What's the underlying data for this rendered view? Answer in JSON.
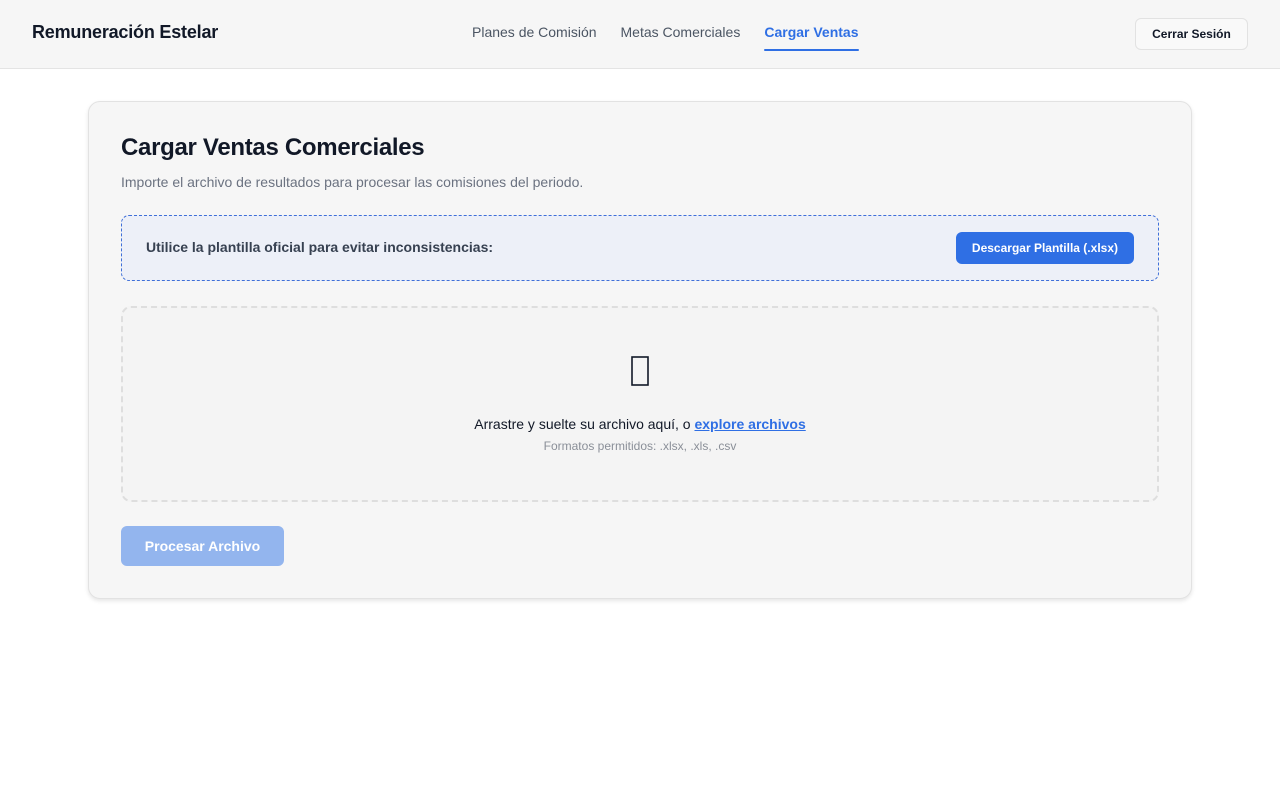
{
  "app": {
    "brand": "Remuneración Estelar"
  },
  "nav": {
    "items": [
      {
        "label": "Planes de Comisión",
        "active": false
      },
      {
        "label": "Metas Comerciales",
        "active": false
      },
      {
        "label": "Cargar Ventas",
        "active": true
      }
    ],
    "logout_label": "Cerrar Sesión"
  },
  "card": {
    "title": "Cargar Ventas Comerciales",
    "subtitle": "Importe el archivo de resultados para procesar las comisiones del periodo.",
    "template": {
      "text": "Utilice la plantilla oficial para evitar inconsistencias:",
      "button_label": "Descargar Plantilla (.xlsx)"
    },
    "dropzone": {
      "icon": "file-upload-icon",
      "prompt": "Arrastre y suelte su archivo aquí, o",
      "browse_label": "explore archivos",
      "formats": "Formatos permitidos: .xlsx, .xls, .csv"
    },
    "process_label": "Procesar Archivo",
    "process_enabled": false
  },
  "colors": {
    "accent": "#2f6fe4",
    "accent_disabled": "#93b5ee",
    "template_bg": "#edf0f8",
    "template_border": "#3f6fd8"
  }
}
